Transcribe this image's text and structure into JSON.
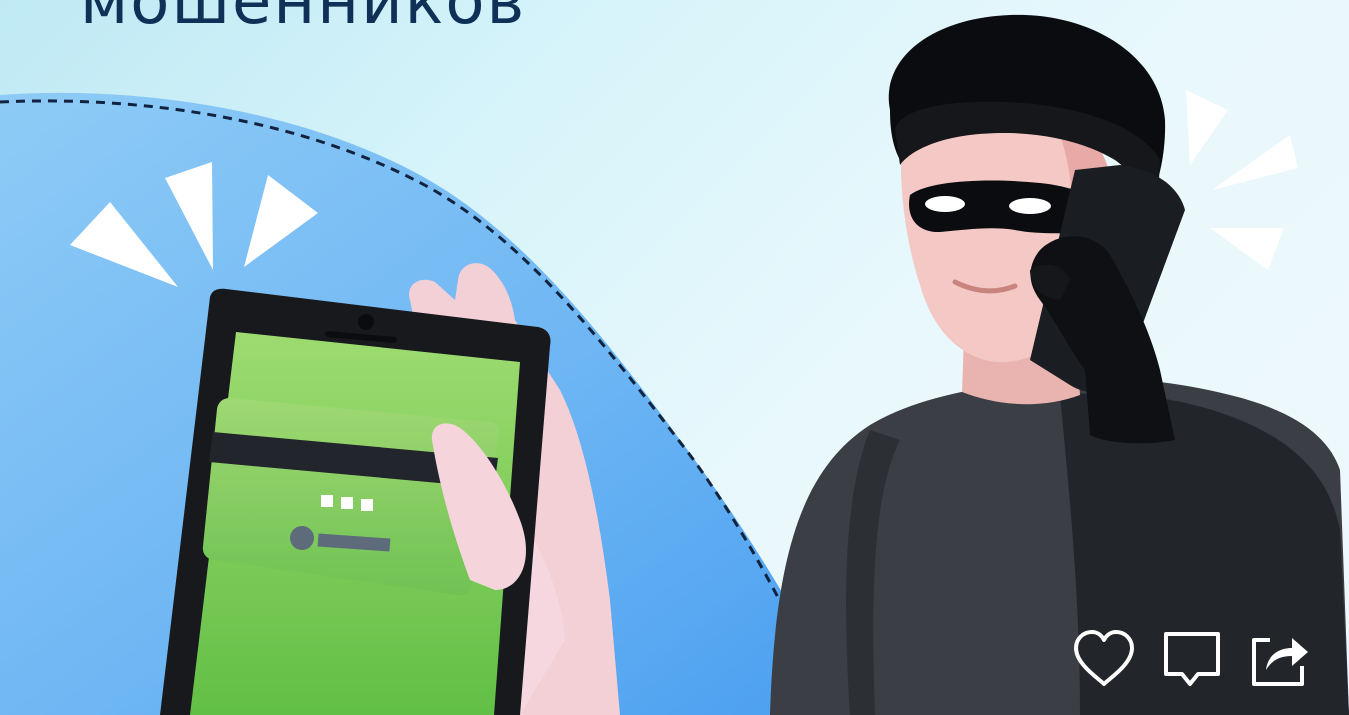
{
  "post": {
    "headline": "мошенников"
  },
  "actions": {
    "like_icon": "heart-icon",
    "comment_icon": "comment-icon",
    "share_icon": "share-icon"
  },
  "colors": {
    "headline": "#0f3057",
    "background": "#d6f4fa",
    "blue_wave": "#5aa7f2",
    "phone_screen": "#86cf5a",
    "villain_shirt": "#3c3f44",
    "skin": "#f2c7c3"
  }
}
